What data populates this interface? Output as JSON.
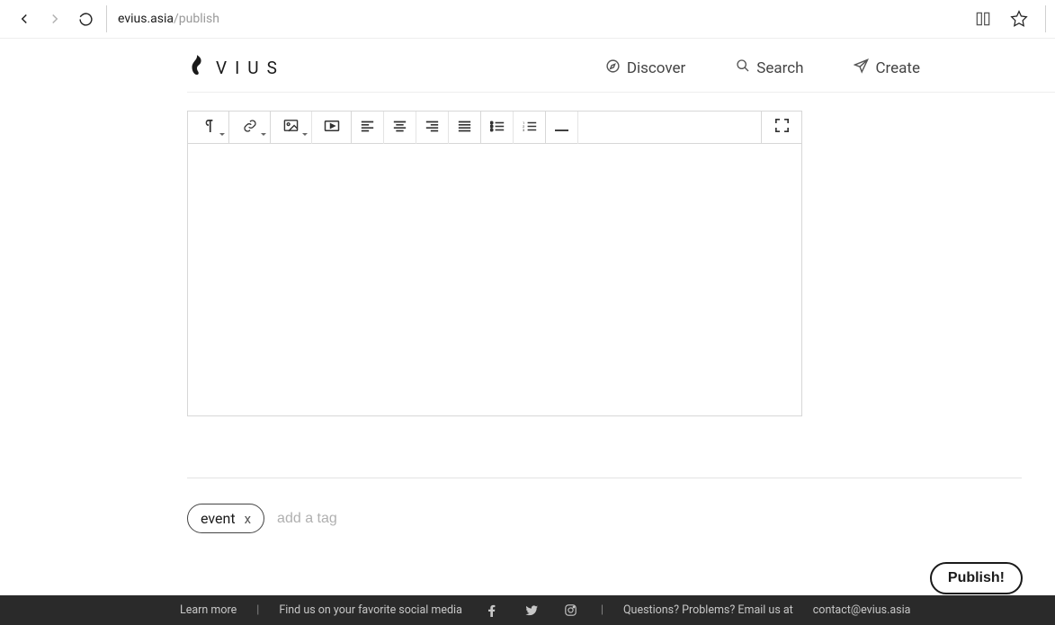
{
  "browser": {
    "url_host": "evius.asia",
    "url_path": "publish"
  },
  "brand": {
    "name": "VIUS"
  },
  "nav": {
    "discover": "Discover",
    "search": "Search",
    "create": "Create"
  },
  "toolbar": {
    "icons": {
      "paragraph": "paragraph-icon",
      "link": "link-icon",
      "image": "image-icon",
      "video": "video-icon",
      "align_left": "align-left-icon",
      "align_center": "align-center-icon",
      "align_right": "align-right-icon",
      "align_justify": "align-justify-icon",
      "ul": "unordered-list-icon",
      "ol": "ordered-list-icon",
      "hr": "horizontal-rule-icon",
      "fullscreen": "fullscreen-icon"
    }
  },
  "tags": {
    "items": [
      {
        "label": "event"
      }
    ],
    "remove_glyph": "x",
    "add_placeholder": "add a tag"
  },
  "publish_label": "Publish!",
  "footer": {
    "learn_more": "Learn more",
    "sep": "|",
    "find_us": "Find us on your favorite social media",
    "questions": "Questions? Problems? Email us at",
    "email": "contact@evius.asia"
  }
}
